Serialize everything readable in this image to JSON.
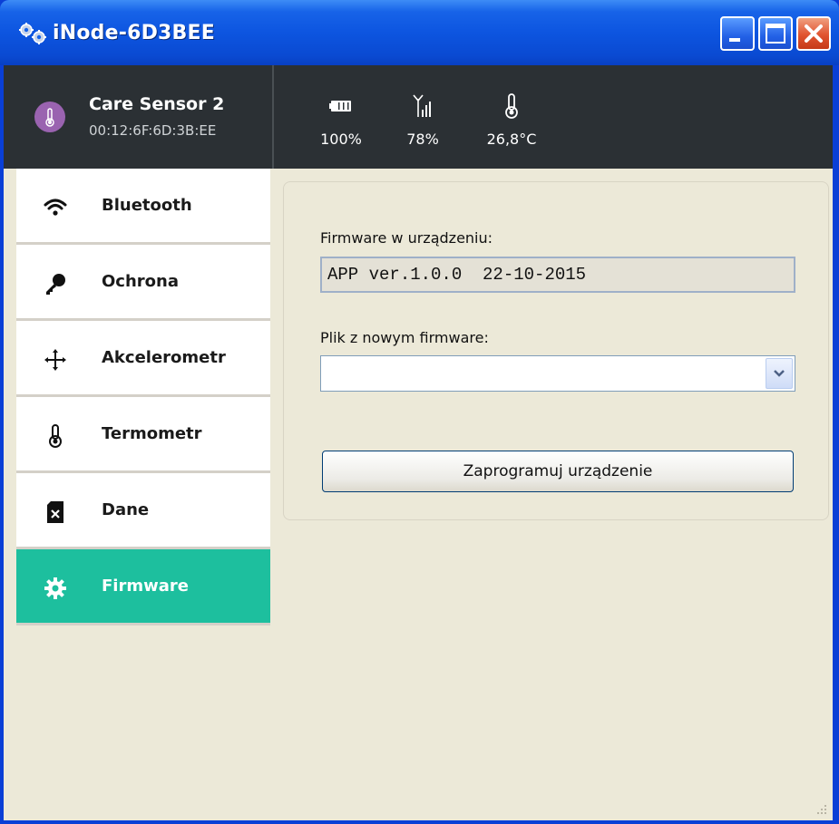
{
  "window": {
    "title": "iNode-6D3BEE",
    "controls": [
      "minimize-icon",
      "maximize-icon",
      "close-icon"
    ]
  },
  "device": {
    "name": "Care Sensor 2",
    "mac": "00:12:6F:6D:3B:EE",
    "avatar_color": "#9a63b0"
  },
  "stats": [
    {
      "icon": "battery-icon",
      "value": "100%"
    },
    {
      "icon": "signal-icon",
      "value": "78%"
    },
    {
      "icon": "thermometer-icon",
      "value": "26,8°C"
    }
  ],
  "sidebar": {
    "items": [
      {
        "label": "Bluetooth",
        "icon": "wifi-icon",
        "active": false
      },
      {
        "label": "Ochrona",
        "icon": "key-icon",
        "active": false
      },
      {
        "label": "Akcelerometr",
        "icon": "move-arrows-icon",
        "active": false
      },
      {
        "label": "Termometr",
        "icon": "thermometer-icon",
        "active": false
      },
      {
        "label": "Dane",
        "icon": "sd-card-icon",
        "active": false
      },
      {
        "label": "Firmware",
        "icon": "gear-icon",
        "active": true
      }
    ],
    "active_color": "#1dbf9e"
  },
  "firmware": {
    "current_label": "Firmware w urządzeniu:",
    "current_value": "APP ver.1.0.0  22-10-2015",
    "new_file_label": "Plik z nowym firmware:",
    "new_file_value": "",
    "program_button": "Zaprogramuj urządzenie"
  }
}
